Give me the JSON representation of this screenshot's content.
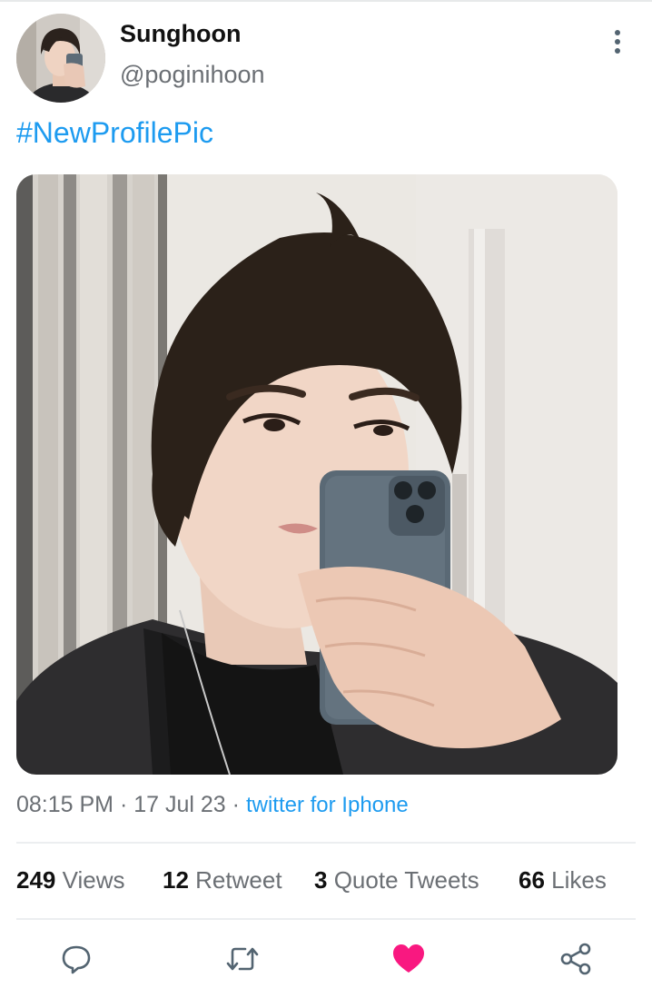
{
  "tweet": {
    "author": {
      "display_name": "Sunghoon",
      "handle": "@poginihoon"
    },
    "text": "#NewProfilePic",
    "time": "08:15 PM",
    "date": "17 Jul 23",
    "separator": "·",
    "source": "twitter for Iphone",
    "stats": {
      "views_count": "249",
      "views_label": "Views",
      "retweets_count": "12",
      "retweets_label": "Retweet",
      "quotes_count": "3",
      "quotes_label": "Quote Tweets",
      "likes_count": "66",
      "likes_label": "Likes"
    }
  },
  "icons": {
    "more": "more-vertical-icon",
    "reply": "reply-icon",
    "retweet": "retweet-icon",
    "like": "heart-icon",
    "share": "share-icon"
  },
  "colors": {
    "link": "#1d9bf0",
    "like_active": "#f91880",
    "secondary_text": "#6b6f74",
    "icon_gray": "#536471"
  }
}
